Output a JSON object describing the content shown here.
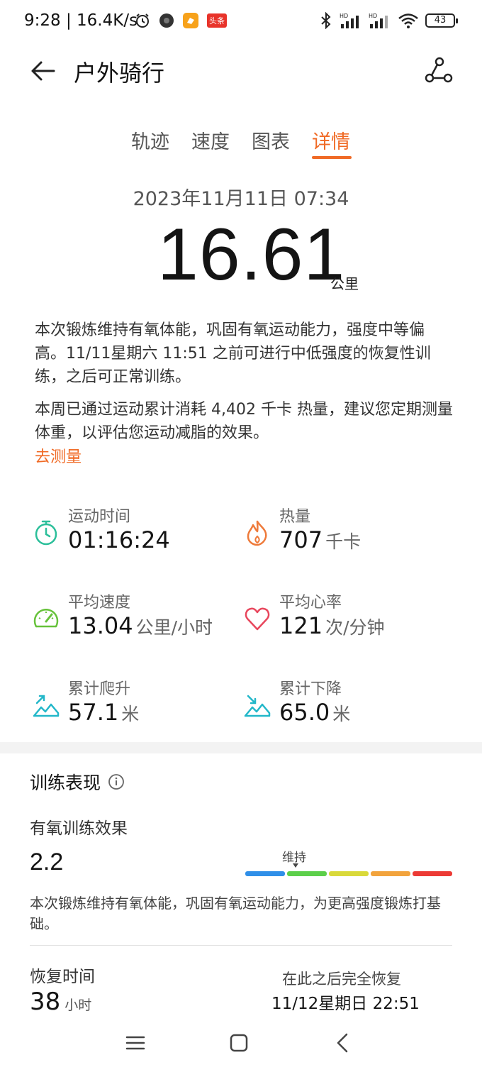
{
  "status_bar": {
    "time_speed": "9:28 | 16.4K/s",
    "badge_text": "头条",
    "battery": "43",
    "hd1": "HD",
    "hd2": "HD"
  },
  "app_bar": {
    "title": "户外骑行"
  },
  "tabs": [
    {
      "label": "轨迹"
    },
    {
      "label": "速度"
    },
    {
      "label": "图表"
    },
    {
      "label": "详情"
    }
  ],
  "summary": {
    "datetime": "2023年11月11日 07:34",
    "distance": "16.61",
    "distance_unit": "公里"
  },
  "descriptions": {
    "p1": "本次锻炼维持有氧体能，巩固有氧运动能力，强度中等偏高。11/11星期六 11:51 之前可进行中低强度的恢复性训练，之后可正常训练。",
    "p2": "本周已通过运动累计消耗 4,402 千卡 热量，建议您定期测量体重，以评估您运动减脂的效果。",
    "link": "去测量"
  },
  "stats": [
    {
      "label": "运动时间",
      "value": "01:16:24",
      "unit": "",
      "icon": "stopwatch-icon",
      "color": "#2bbf9a"
    },
    {
      "label": "热量",
      "value": "707",
      "unit": "千卡",
      "icon": "flame-icon",
      "color": "#ee7a3a"
    },
    {
      "label": "平均速度",
      "value": "13.04",
      "unit": "公里/小时",
      "icon": "speedometer-icon",
      "color": "#66c23a"
    },
    {
      "label": "平均心率",
      "value": "121",
      "unit": "次/分钟",
      "icon": "heart-icon",
      "color": "#e8465c"
    },
    {
      "label": "累计爬升",
      "value": "57.1",
      "unit": "米",
      "icon": "climb-icon",
      "color": "#22b7c9"
    },
    {
      "label": "累计下降",
      "value": "65.0",
      "unit": "米",
      "icon": "descent-icon",
      "color": "#22b7c9"
    }
  ],
  "performance": {
    "title": "训练表现",
    "aerobic_label": "有氧训练效果",
    "aerobic_value": "2.2",
    "scale_label": "维持",
    "scale_colors": [
      "#2f8fe8",
      "#5ccf4a",
      "#d9d93a",
      "#f2a33c",
      "#ec3a35"
    ],
    "desc": "本次锻炼维持有氧体能，巩固有氧运动能力，为更高强度锻炼打基础。",
    "recovery_label": "恢复时间",
    "recovery_value": "38",
    "recovery_unit": "小时",
    "recover_after": "在此之后完全恢复",
    "recover_at": "11/12星期日 22:51"
  },
  "colors": {
    "accent": "#f06a25"
  }
}
